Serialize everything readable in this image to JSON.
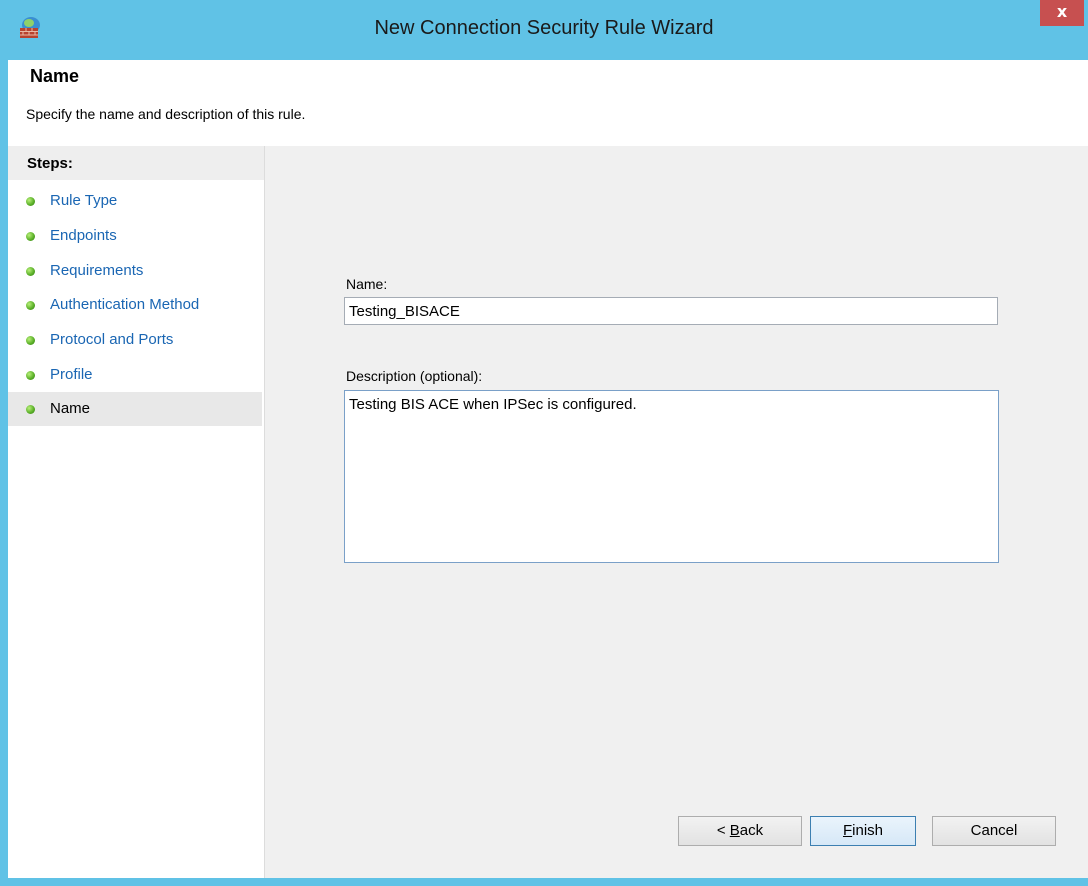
{
  "window": {
    "title": "New Connection Security Rule Wizard",
    "close_label": "x"
  },
  "header": {
    "title": "Name",
    "subtitle": "Specify the name and description of this rule."
  },
  "steps": {
    "heading": "Steps:",
    "items": [
      {
        "label": "Rule Type"
      },
      {
        "label": "Endpoints"
      },
      {
        "label": "Requirements"
      },
      {
        "label": "Authentication Method"
      },
      {
        "label": "Protocol and Ports"
      },
      {
        "label": "Profile"
      },
      {
        "label": "Name"
      }
    ],
    "active_index": 6
  },
  "form": {
    "name_label": "Name:",
    "name_value": "Testing_BISACE",
    "description_label": "Description (optional):",
    "description_value": "Testing BIS ACE when IPSec is configured."
  },
  "buttons": {
    "back": {
      "prefix": "< ",
      "mnemonic": "B",
      "rest": "ack"
    },
    "finish": {
      "mnemonic": "F",
      "rest": "inish"
    },
    "cancel": "Cancel"
  },
  "colors": {
    "titlebar": "#60c2e6",
    "step_link": "#1a66b3",
    "close_button": "#c75050"
  }
}
